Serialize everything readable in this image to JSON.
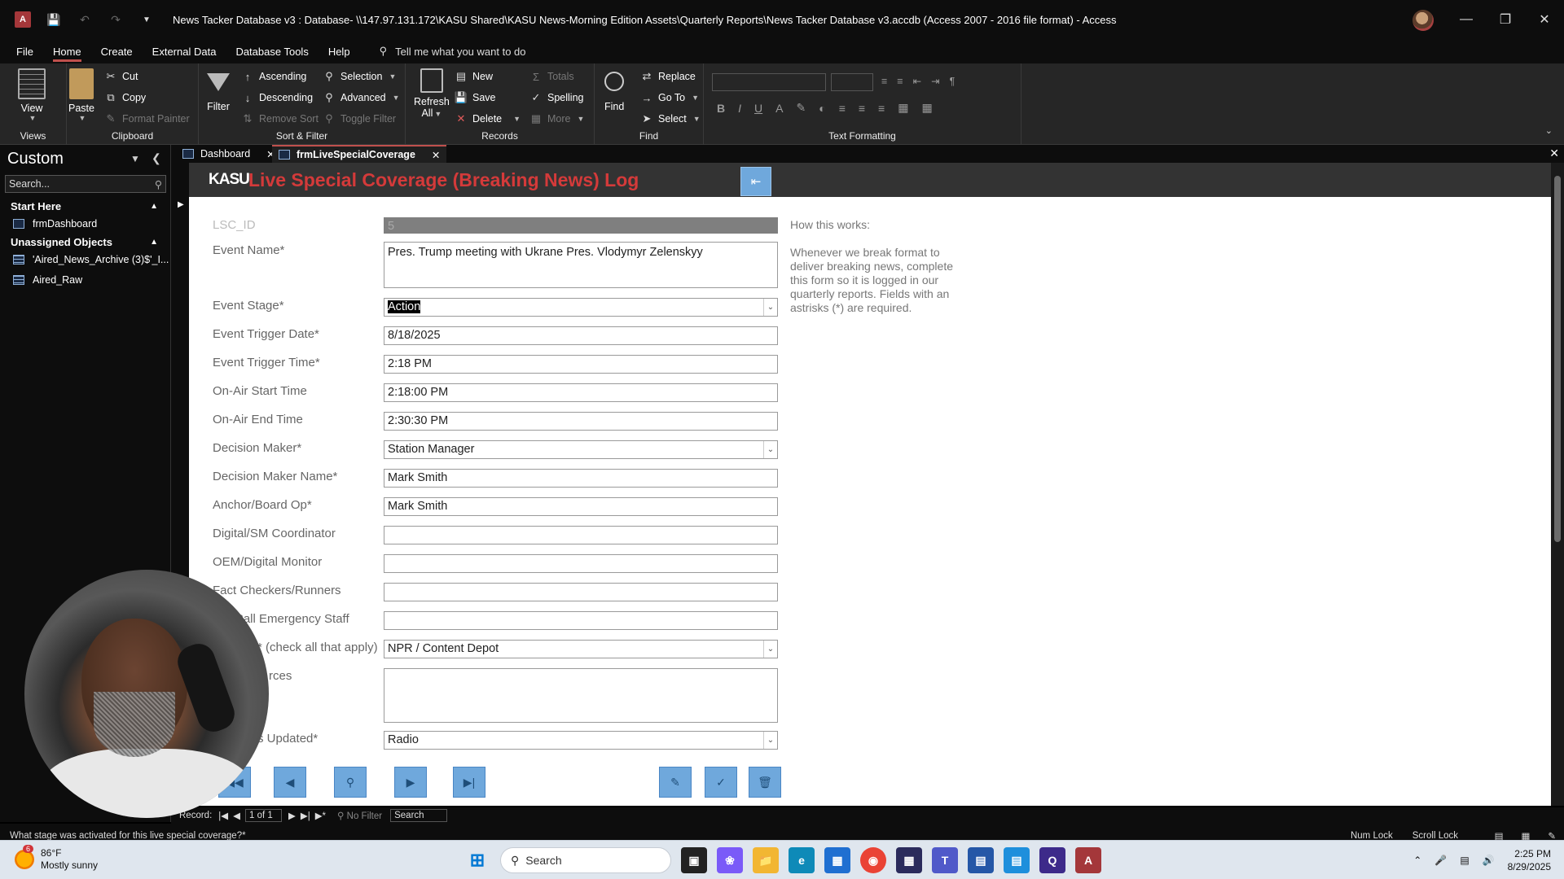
{
  "window": {
    "title": "News Tacker Database v3 : Database- \\\\147.97.131.172\\KASU Shared\\KASU News-Morning Edition Assets\\Quarterly Reports\\News Tacker Database v3.accdb (Access 2007 - 2016 file format)  -  Access"
  },
  "menu": {
    "tabs": [
      "File",
      "Home",
      "Create",
      "External Data",
      "Database Tools",
      "Help"
    ],
    "active": "Home",
    "tell_me": "Tell me what you want to do"
  },
  "ribbon": {
    "views": {
      "view": "View",
      "label": "Views"
    },
    "clipboard": {
      "paste": "Paste",
      "cut": "Cut",
      "copy": "Copy",
      "format_painter": "Format Painter",
      "label": "Clipboard"
    },
    "sort_filter": {
      "filter": "Filter",
      "ascending": "Ascending",
      "descending": "Descending",
      "remove_sort": "Remove Sort",
      "selection": "Selection",
      "advanced": "Advanced",
      "toggle_filter": "Toggle Filter",
      "label": "Sort & Filter"
    },
    "records": {
      "refresh": "Refresh",
      "refresh_all": "All",
      "new": "New",
      "save": "Save",
      "delete": "Delete",
      "totals": "Totals",
      "spelling": "Spelling",
      "more": "More",
      "label": "Records"
    },
    "find": {
      "find": "Find",
      "replace": "Replace",
      "goto": "Go To",
      "select": "Select",
      "label": "Find"
    },
    "text_formatting": {
      "label": "Text Formatting"
    }
  },
  "nav": {
    "title": "Custom",
    "search_placeholder": "Search...",
    "sections": [
      {
        "title": "Start Here",
        "items": [
          {
            "label": "frmDashboard",
            "type": "form"
          }
        ]
      },
      {
        "title": "Unassigned Objects",
        "items": [
          {
            "label": "'Aired_News_Archive (3)$'_I...",
            "type": "table"
          },
          {
            "label": "Aired_Raw",
            "type": "table"
          }
        ]
      }
    ]
  },
  "doc_tabs": [
    {
      "label": "Dashboard"
    },
    {
      "label": "frmLiveSpecialCoverage",
      "active": true
    }
  ],
  "form": {
    "logo": "KASU",
    "title": "Live Special Coverage (Breaking News) Log",
    "fields": {
      "lsc_id": {
        "label": "LSC_ID",
        "value": "5"
      },
      "event_name": {
        "label": "Event Name*",
        "value": "Pres. Trump meeting with Ukrane Pres. Vlodymyr Zelenskyy"
      },
      "event_stage": {
        "label": "Event Stage*",
        "value": "Action"
      },
      "trigger_date": {
        "label": "Event Trigger Date*",
        "value": "8/18/2025"
      },
      "trigger_time": {
        "label": "Event Trigger Time*",
        "value": "2:18 PM"
      },
      "onair_start": {
        "label": "On-Air Start Time",
        "value": "2:18:00 PM"
      },
      "onair_end": {
        "label": "On-Air End Time",
        "value": "2:30:30 PM"
      },
      "decision_maker": {
        "label": "Decision Maker*",
        "value": "Station Manager"
      },
      "decision_maker_name": {
        "label": "Decision Maker Name*",
        "value": "Mark Smith"
      },
      "anchor": {
        "label": "Anchor/Board Op*",
        "value": "Mark Smith"
      },
      "digital_coord": {
        "label": "Digital/SM Coordinator",
        "value": ""
      },
      "oem_monitor": {
        "label": "OEM/Digital Monitor",
        "value": ""
      },
      "fact_checkers": {
        "label": "Fact Checkers/Runners",
        "value": ""
      },
      "oncall": {
        "label": "Call Emergency Staff",
        "value": ""
      },
      "sources_apply": {
        "label": "* (check all that apply)",
        "value": "NPR / Content Depot"
      },
      "other_sources": {
        "label": "rces",
        "value": ""
      },
      "updated": {
        "label": "s Updated*",
        "value": "Radio"
      }
    },
    "help_heading": "How this works:",
    "help_text": "Whenever we break format to deliver breaking news, complete this form so it is logged in our quarterly reports.  Fields with an astrisks (*) are required."
  },
  "record_nav": {
    "label": "Record:",
    "position": "1 of 1",
    "filter": "No Filter",
    "search": "Search"
  },
  "status": {
    "text": "What stage was activated for this live special coverage?*",
    "num_lock": "Num Lock",
    "scroll_lock": "Scroll Lock"
  },
  "taskbar": {
    "temp": "86°F",
    "weather": "Mostly sunny",
    "weather_badge": "6",
    "search": "Search",
    "time": "2:25 PM",
    "date": "8/29/2025"
  }
}
